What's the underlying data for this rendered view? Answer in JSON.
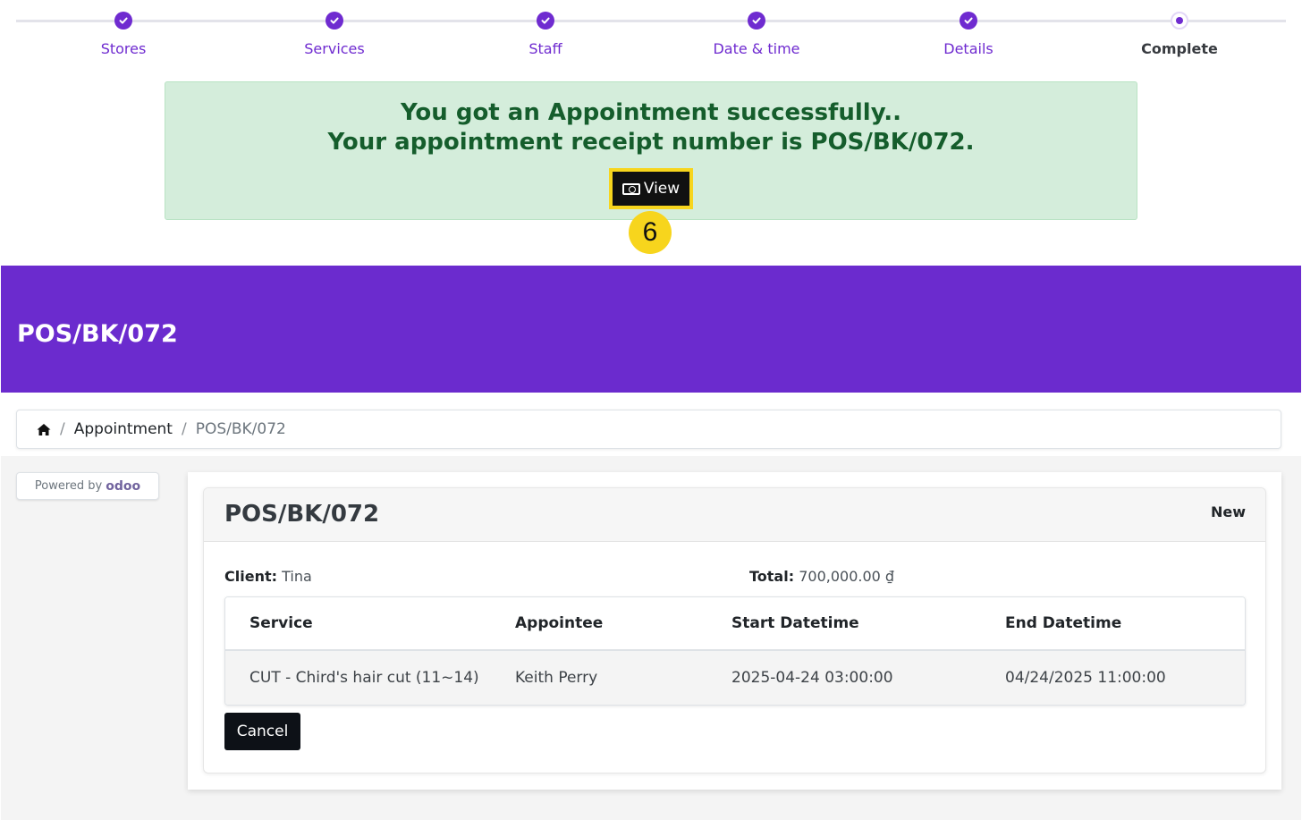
{
  "steps": [
    {
      "label": "Stores",
      "state": "done"
    },
    {
      "label": "Services",
      "state": "done"
    },
    {
      "label": "Staff",
      "state": "done"
    },
    {
      "label": "Date & time",
      "state": "done"
    },
    {
      "label": "Details",
      "state": "done"
    },
    {
      "label": "Complete",
      "state": "current"
    }
  ],
  "alert": {
    "line1": "You got an Appointment successfully..",
    "line2": "Your appointment receipt number is POS/BK/072.",
    "view_label": "View",
    "view_icon": "money-bill-icon"
  },
  "annotation": {
    "number": "6"
  },
  "hero": {
    "title": "POS/BK/072"
  },
  "breadcrumb": {
    "home_icon": "home-icon",
    "sep1": "/",
    "link": "Appointment",
    "sep2": "/",
    "current": "POS/BK/072"
  },
  "powered": {
    "prefix": "Powered by",
    "logo_main": "odoo"
  },
  "appointment": {
    "title": "POS/BK/072",
    "status": "New",
    "client_label": "Client:",
    "client_value": "Tina",
    "total_label": "Total:",
    "total_value": "700,000.00 ₫",
    "columns": [
      "Service",
      "Appointee",
      "Start Datetime",
      "End Datetime"
    ],
    "rows": [
      [
        "CUT - Chird's hair cut (11~14)",
        "Keith Perry",
        "2025-04-24 03:00:00",
        "04/24/2025 11:00:00"
      ]
    ],
    "cancel_label": "Cancel"
  },
  "colors": {
    "brand_purple": "#6b2bce",
    "success_bg": "#d4eddb",
    "success_text": "#155d2c",
    "highlight_yellow": "#f7d51d"
  }
}
